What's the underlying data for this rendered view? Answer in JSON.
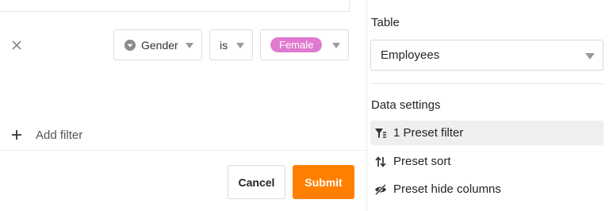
{
  "filter_row": {
    "field": "Gender",
    "operator": "is",
    "value": "Female",
    "value_color": "#e07ad0"
  },
  "add_filter_label": "Add filter",
  "buttons": {
    "cancel": "Cancel",
    "submit": "Submit",
    "submit_color": "#ff8000"
  },
  "sidebar": {
    "table_label": "Table",
    "table_value": "Employees",
    "data_settings_label": "Data settings",
    "items": [
      {
        "label": "1 Preset filter",
        "icon": "filter-icon",
        "active": true
      },
      {
        "label": "Preset sort",
        "icon": "sort-icon",
        "active": false
      },
      {
        "label": "Preset hide columns",
        "icon": "eye-off-icon",
        "active": false
      }
    ]
  }
}
